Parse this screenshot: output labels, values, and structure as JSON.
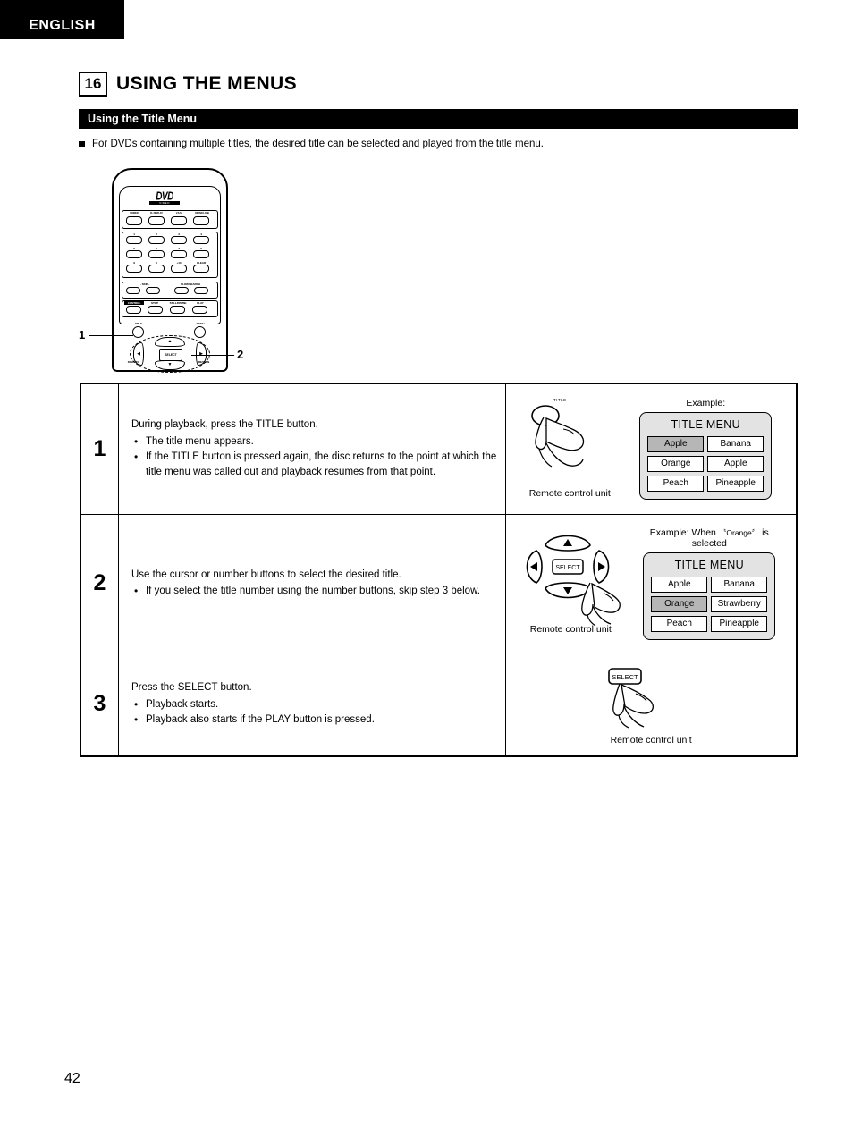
{
  "language_tab": "ENGLISH",
  "chapter": {
    "number": "16",
    "title": "USING THE MENUS"
  },
  "section_bar": "Using the Title Menu",
  "intro": "For DVDs containing multiple titles, the desired title can be selected and played from the title menu.",
  "remote": {
    "logo": "DVD",
    "logo_sub": "VIDEO",
    "top_buttons": [
      "POWER",
      "FL DISPLAY",
      "V.S.S.",
      "OPEN/CLOSE"
    ],
    "number_buttons": [
      "1",
      "2",
      "3",
      "4",
      "5",
      "6",
      "7",
      "8",
      "9",
      "0",
      "+10",
      "CLEAR"
    ],
    "skip_label": "- SKIP -",
    "search_label": "SLOW/SEARCH",
    "transport_labels": [
      "CONTROL",
      "STOP",
      "STILL/PAUSE",
      "PLAY"
    ],
    "title_label": "TITLE",
    "menu_label": "MENU",
    "display_label": "DISPLAY",
    "return_label": "RETURN",
    "select_label": "SELECT",
    "callout_1": "1",
    "callout_2": "2"
  },
  "steps": [
    {
      "number": "1",
      "lead": "During playback, press the TITLE button.",
      "bullets": [
        "The title menu appears.",
        "If the TITLE button is pressed again, the disc returns to the point at which the title menu was called out and playback resumes from that point."
      ],
      "illustration": {
        "button_label": "TITLE",
        "caption": "Remote control unit",
        "example_prefix": "Example:",
        "example_quoted": "",
        "example_suffix": "",
        "menu_title": "TITLE MENU",
        "menu_items": [
          {
            "label": "Apple",
            "selected": true
          },
          {
            "label": "Banana",
            "selected": false
          },
          {
            "label": "Orange",
            "selected": false
          },
          {
            "label": "Apple",
            "selected": false
          },
          {
            "label": "Peach",
            "selected": false
          },
          {
            "label": "Pineapple",
            "selected": false
          }
        ]
      }
    },
    {
      "number": "2",
      "lead": "Use the cursor or number buttons to select the desired title.",
      "bullets": [
        "If you select the title number using the number buttons, skip step 3 below."
      ],
      "illustration": {
        "button_label": "SELECT",
        "caption": "Remote control unit",
        "example_prefix": "Example: When",
        "example_quoted": "Orange",
        "example_suffix": "is selected",
        "menu_title": "TITLE MENU",
        "menu_items": [
          {
            "label": "Apple",
            "selected": false
          },
          {
            "label": "Banana",
            "selected": false
          },
          {
            "label": "Orange",
            "selected": true
          },
          {
            "label": "Strawberry",
            "selected": false
          },
          {
            "label": "Peach",
            "selected": false
          },
          {
            "label": "Pineapple",
            "selected": false
          }
        ]
      }
    },
    {
      "number": "3",
      "lead": "Press the SELECT button.",
      "bullets": [
        "Playback starts.",
        "Playback also starts if the PLAY button is pressed."
      ],
      "illustration": {
        "button_label": "SELECT",
        "caption": "Remote control unit"
      }
    }
  ],
  "page_number": "42",
  "colors": {
    "bar_background": "#000000",
    "bar_text": "#ffffff",
    "menu_background": "#e3e3e3",
    "menu_cell": "#ffffff",
    "menu_cell_selected": "#b6b6b6"
  }
}
